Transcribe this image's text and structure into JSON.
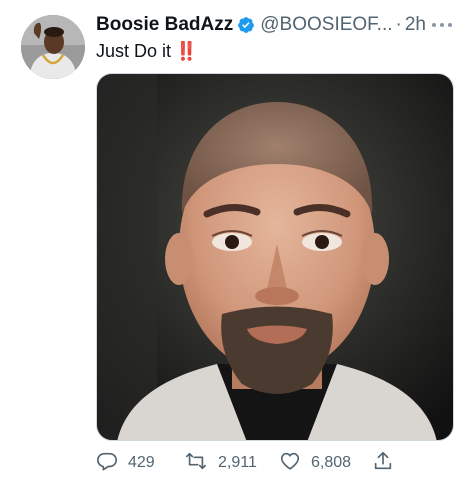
{
  "tweet": {
    "display_name": "Boosie BadAzz",
    "verified_icon": "verified-badge-icon",
    "handle": "@BOOSIEOF...",
    "separator": "·",
    "time": "2h",
    "more_icon": "more-options-icon",
    "text": "Just Do it",
    "text_emoji": "‼️",
    "media_alt_icon": "photo-image",
    "stats": {
      "replies": "429",
      "retweets": "2,911",
      "likes": "6,808"
    }
  },
  "colors": {
    "text_primary": "#0f1419",
    "text_secondary": "#536471",
    "verified_blue": "#1d9bf0",
    "emoji_red": "#d9202a"
  }
}
